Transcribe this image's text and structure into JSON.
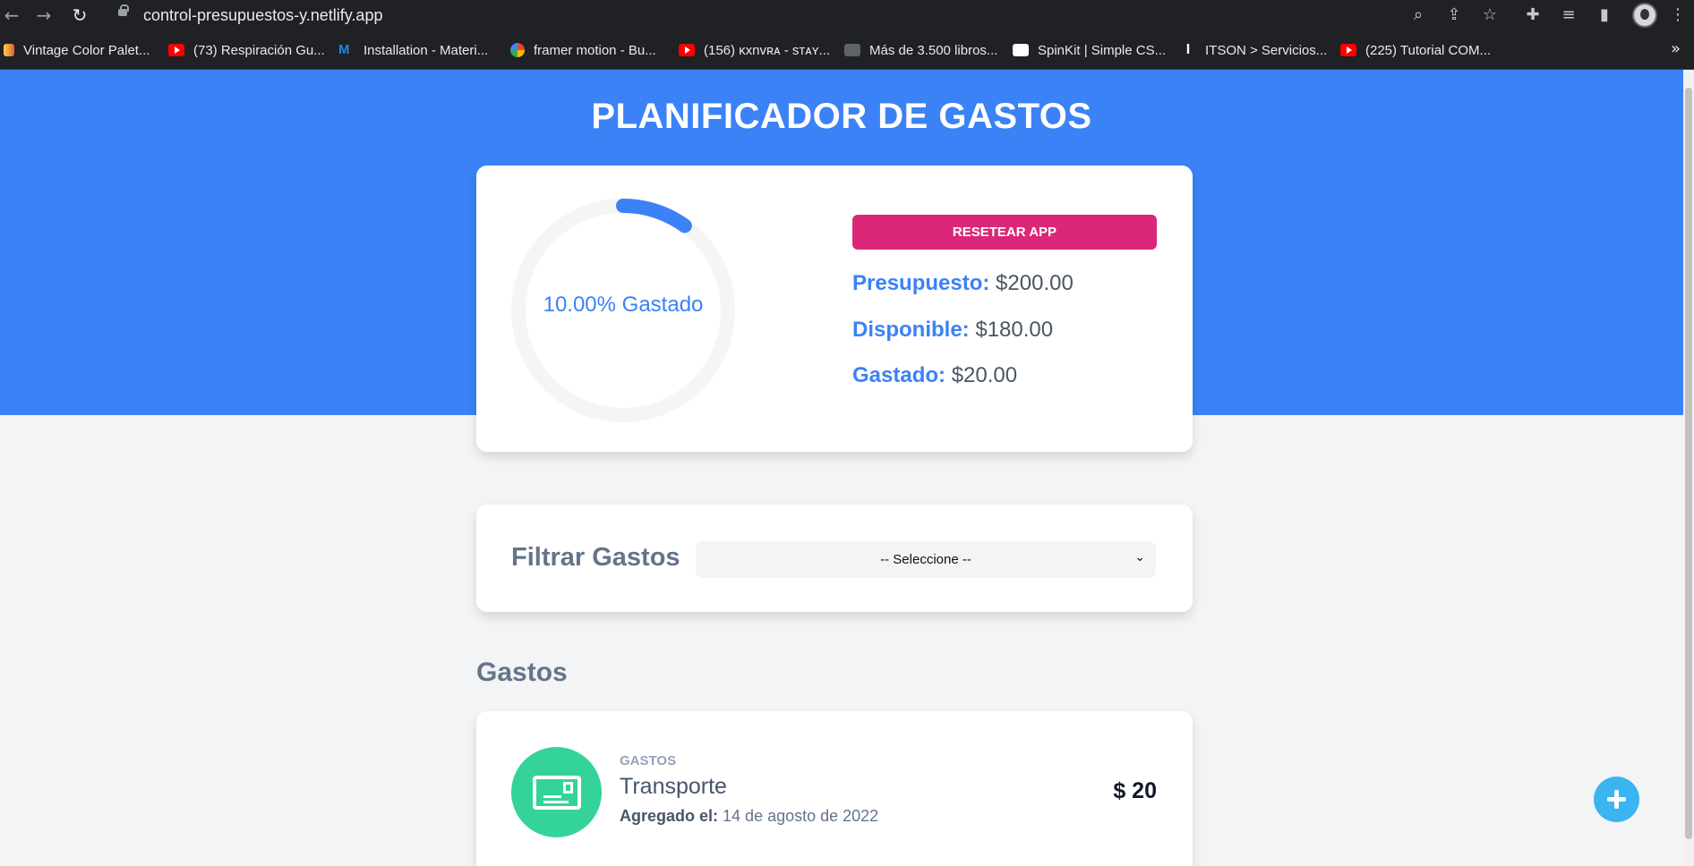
{
  "browser": {
    "url": "control-presupuestos-y.netlify.app",
    "bookmarks": [
      {
        "label": "Vintage Color Palet...",
        "icon": "palette-icon"
      },
      {
        "label": "(73) Respiración Gu...",
        "icon": "youtube-icon"
      },
      {
        "label": "Installation - Materi...",
        "icon": "mui-icon"
      },
      {
        "label": "framer motion - Bu...",
        "icon": "google-icon"
      },
      {
        "label": "(156) ĸxnvʀᴀ - sᴛᴀʏ...",
        "icon": "youtube-icon"
      },
      {
        "label": "Más de 3.500 libros...",
        "icon": "book-icon"
      },
      {
        "label": "SpinKit | Simple CS...",
        "icon": "spinkit-icon"
      },
      {
        "label": "ITSON > Servicios...",
        "icon": "itson-icon"
      },
      {
        "label": "(225) Tutorial COM...",
        "icon": "youtube-icon"
      }
    ],
    "more": "»"
  },
  "app": {
    "title": "PLANIFICADOR DE GASTOS",
    "progress": {
      "percent": 10,
      "label": "10.00% Gastado",
      "color": "#3b82f6",
      "track_color": "#f5f5f5"
    },
    "reset_label": "RESETEAR APP",
    "budget": {
      "label": "Presupuesto:",
      "value": "$200.00"
    },
    "available": {
      "label": "Disponible:",
      "value": "$180.00"
    },
    "spent": {
      "label": "Gastado:",
      "value": "$20.00"
    },
    "filter": {
      "label": "Filtrar Gastos",
      "selected": "-- Seleccione --"
    },
    "expenses_title": "Gastos",
    "expenses": [
      {
        "category": "GASTOS",
        "name": "Transporte",
        "date_label": "Agregado el:",
        "date": "14 de agosto de 2022",
        "amount": "$ 20",
        "icon": "expense-card-icon"
      }
    ]
  },
  "colors": {
    "hero": "#3b82f6",
    "reset": "#db2777",
    "expense_icon_bg": "#34d399",
    "fab": "#3bb4f2"
  }
}
